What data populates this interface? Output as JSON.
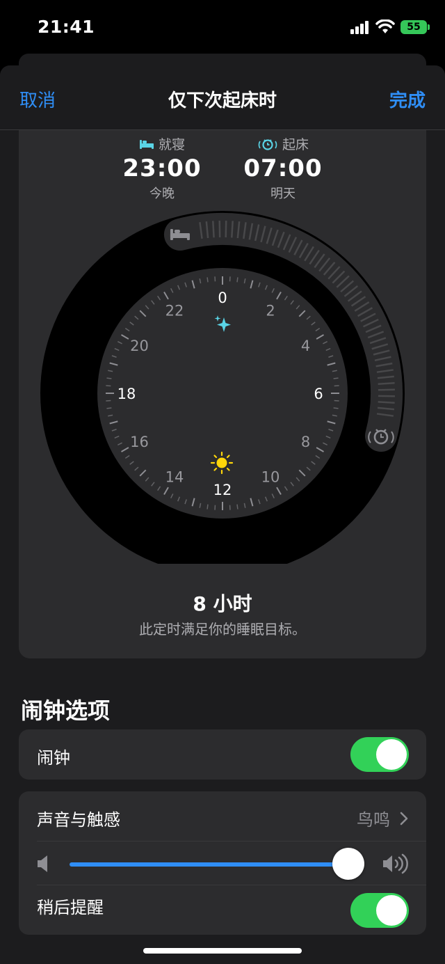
{
  "status_bar": {
    "time": "21:41",
    "battery": "55"
  },
  "nav": {
    "cancel": "取消",
    "title": "仅下次起床时",
    "done": "完成"
  },
  "bedtime": {
    "label": "就寝",
    "time": "23:00",
    "day": "今晚"
  },
  "wake": {
    "label": "起床",
    "time": "07:00",
    "day": "明天"
  },
  "clock": {
    "numbers": [
      "0",
      "2",
      "4",
      "6",
      "8",
      "10",
      "12",
      "14",
      "16",
      "18",
      "20",
      "22"
    ]
  },
  "duration": {
    "main": "8 小时",
    "sub": "此定时满足你的睡眠目标。"
  },
  "alarm_options": {
    "title": "闹钟选项",
    "alarm_label": "闹钟",
    "alarm_on": true,
    "sound_label": "声音与触感",
    "sound_value": "鸟鸣",
    "volume": 1.0,
    "snooze_label": "稍后提醒",
    "snooze_on": true
  },
  "colors": {
    "accent": "#2f8ef6",
    "toggle_on": "#32d158",
    "bedtime_icon": "#5ad4e6",
    "sun": "#ffd60a"
  }
}
